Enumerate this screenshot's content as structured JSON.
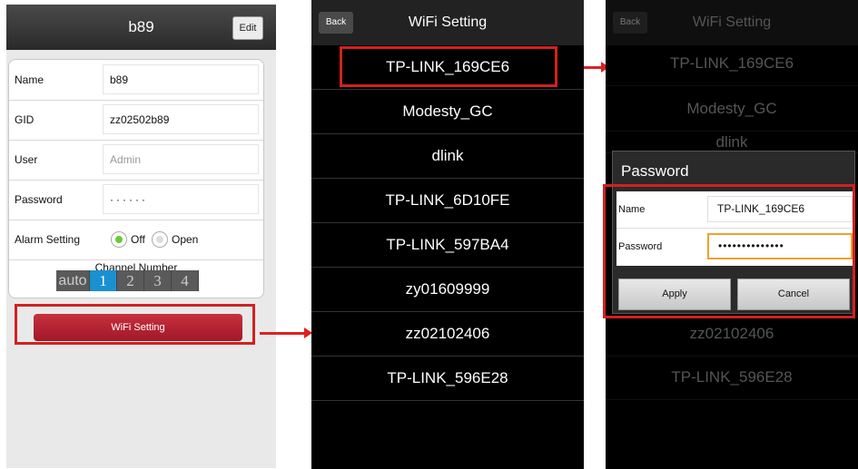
{
  "panel1": {
    "title": "b89",
    "edit_label": "Edit",
    "fields": [
      {
        "label": "Name",
        "value": "b89"
      },
      {
        "label": "GID",
        "value": "zz02502b89"
      },
      {
        "label": "User",
        "placeholder": "Admin"
      },
      {
        "label": "Password",
        "value": "······"
      }
    ],
    "alarm": {
      "label": "Alarm Setting",
      "off": "Off",
      "open": "Open",
      "selected": "Off"
    },
    "channel": {
      "label": "Channel Number",
      "options": [
        "auto",
        "1",
        "2",
        "3",
        "4"
      ],
      "selected": "1"
    },
    "wifi_button": "WiFi Setting"
  },
  "panel2": {
    "back_label": "Back",
    "title": "WiFi Setting",
    "networks": [
      "TP-LINK_169CE6",
      "Modesty_GC",
      "dlink",
      "TP-LINK_6D10FE",
      "TP-LINK_597BA4",
      "zy01609999",
      "zz02102406",
      "TP-LINK_596E28"
    ]
  },
  "panel3": {
    "back_label": "Back",
    "title": "WiFi Setting",
    "networks_visible": [
      "TP-LINK_169CE6",
      "Modesty_GC",
      "dlink",
      "zz02102406",
      "TP-LINK_596E28"
    ],
    "dialog": {
      "title": "Password",
      "name_label": "Name",
      "name_value": "TP-LINK_169CE6",
      "password_label": "Password",
      "password_value": "••••••••••••••",
      "apply_label": "Apply",
      "cancel_label": "Cancel"
    }
  },
  "colors": {
    "highlight": "#d42020",
    "accent_blue": "#1a90d0",
    "wifi_button": "#b02030",
    "radio_on": "#66cc33",
    "focus_border": "#f0a030"
  }
}
